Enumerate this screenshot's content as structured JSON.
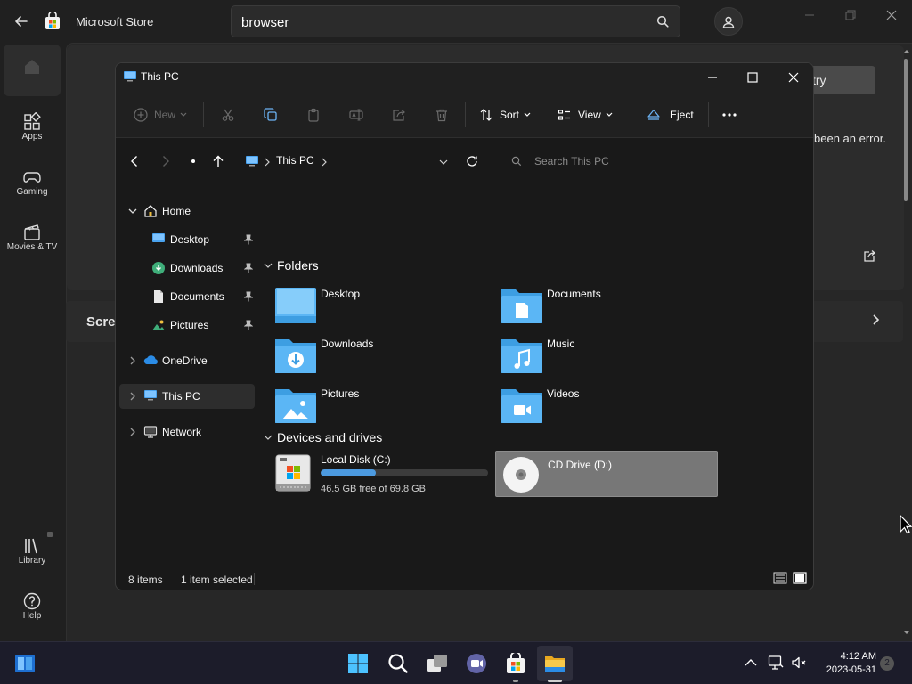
{
  "store": {
    "app_title": "Microsoft Store",
    "search_value": "browser",
    "nav": [
      {
        "label": ""
      },
      {
        "label": "Apps"
      },
      {
        "label": "Gaming"
      },
      {
        "label": "Movies & TV"
      },
      {
        "label": "Library"
      },
      {
        "label": "Help"
      }
    ],
    "retry_fragment": "try",
    "error_fragment": "been an error.",
    "screenshots_fragment": "Scre"
  },
  "explorer": {
    "title": "This PC",
    "toolbar": {
      "new_label": "New",
      "sort_label": "Sort",
      "view_label": "View",
      "eject_label": "Eject"
    },
    "address": {
      "path_label": "This PC"
    },
    "search": {
      "placeholder": "Search This PC"
    },
    "nav": {
      "home": "Home",
      "quick_access": [
        {
          "label": "Desktop"
        },
        {
          "label": "Downloads"
        },
        {
          "label": "Documents"
        },
        {
          "label": "Pictures"
        }
      ],
      "onedrive": "OneDrive",
      "this_pc": "This PC",
      "network": "Network"
    },
    "folders_header": "Folders",
    "folders": [
      {
        "name": "Desktop"
      },
      {
        "name": "Documents"
      },
      {
        "name": "Downloads"
      },
      {
        "name": "Music"
      },
      {
        "name": "Pictures"
      },
      {
        "name": "Videos"
      }
    ],
    "devices_header": "Devices and drives",
    "drives": [
      {
        "name": "Local Disk (C:)",
        "free_text": "46.5 GB free of 69.8 GB",
        "used_fraction": 0.33
      },
      {
        "name": "CD Drive (D:)"
      }
    ],
    "status": {
      "items": "8 items",
      "selected": "1 item selected"
    }
  },
  "taskbar": {
    "time": "4:12 AM",
    "date": "2023-05-31",
    "notification_count": "2"
  },
  "colors": {
    "accent_blue": "#4c9ae0",
    "folder_blue": "#5bb6f5",
    "selection_gray": "#777777"
  }
}
